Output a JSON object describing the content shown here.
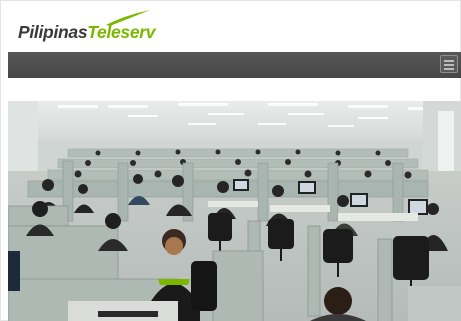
{
  "brand": {
    "name_part_1": "Pilipinas",
    "name_part_2": "Teleserv",
    "logo_icon": "green-swoosh-icon",
    "colors": {
      "dark": "#3a3a3a",
      "green": "#7ab800"
    }
  },
  "navbar": {
    "background": "#4d4d4d",
    "menu_icon": "hamburger-menu-icon"
  },
  "hero": {
    "image": "call-center-floor-photo"
  }
}
